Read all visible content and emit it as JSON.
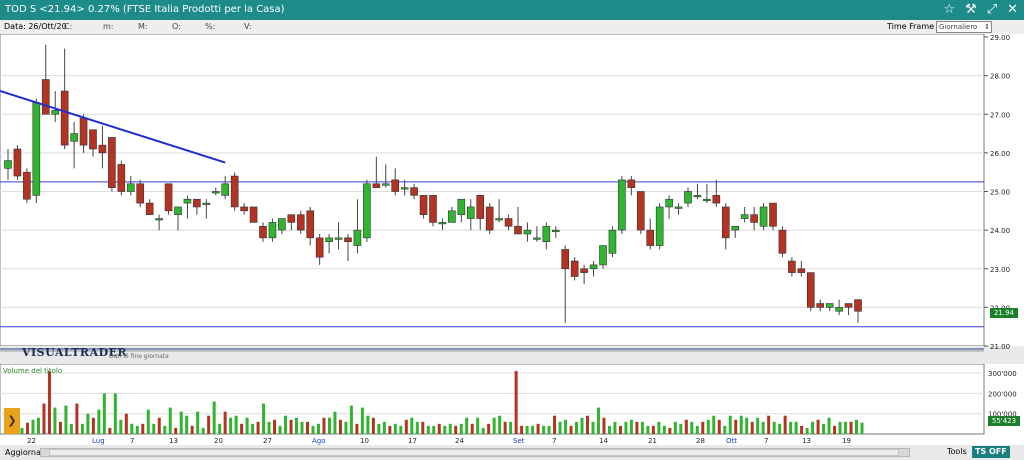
{
  "window": {
    "title": "TOD S <21.94> 0.27%  (FTSE Italia Prodotti per la Casa)",
    "icons": [
      "star-icon",
      "settings-icon",
      "restore-icon",
      "close-icon"
    ]
  },
  "infobar": {
    "data_label": "Data: 26/Ott/20",
    "fields": [
      "C:",
      "m:",
      "M:",
      "O:",
      "%:",
      "V:"
    ],
    "time_frame_label": "Time Frame",
    "time_frame_value": "Giornaliero"
  },
  "chart": {
    "brand": "VISUALTRADER",
    "eod_note": "Dati di fine giornata",
    "volume_label": "Volume del titolo",
    "last_price_label": "21.94",
    "last_volume_label": "55'423",
    "price_ticks": [
      "29.00",
      "28.00",
      "27.00",
      "26.00",
      "25.00",
      "24.00",
      "23.00",
      "22.00",
      "21.00"
    ],
    "volume_ticks": [
      "300'000",
      "200'000",
      "100'000"
    ],
    "x_labels": [
      "22",
      "Lug",
      "7",
      "13",
      "20",
      "27",
      "Ago",
      "10",
      "17",
      "24",
      "Set",
      "7",
      "14",
      "21",
      "28",
      "Ott",
      "7",
      "13",
      "19"
    ],
    "x_labels_blue": [
      "Lug",
      "Ago",
      "Set",
      "Ott"
    ]
  },
  "statusbar": {
    "aggiorna": "Aggiorna",
    "tools": "Tools",
    "ts_off": "TS OFF"
  },
  "colors": {
    "up": "#2fb52f",
    "down": "#b53322",
    "volume": "#2fb52f",
    "accent": "#137f80",
    "trendline": "#1f2fd0",
    "hline": "#3a3ad0"
  },
  "chart_data": {
    "type": "candlestick",
    "title": "TOD S <21.94> 0.27%  (FTSE Italia Prodotti per la Casa)",
    "ylim": [
      21.0,
      29.0
    ],
    "volume_ylim": [
      0,
      300000
    ],
    "candles": [
      {
        "o": 25.6,
        "h": 26.1,
        "l": 25.3,
        "c": 25.8
      },
      {
        "o": 26.1,
        "h": 26.2,
        "l": 25.3,
        "c": 25.4
      },
      {
        "o": 25.5,
        "h": 25.6,
        "l": 24.7,
        "c": 24.8
      },
      {
        "o": 24.9,
        "h": 27.4,
        "l": 24.7,
        "c": 27.3
      },
      {
        "o": 27.9,
        "h": 28.8,
        "l": 27.0,
        "c": 27.0
      },
      {
        "o": 27.0,
        "h": 27.6,
        "l": 26.8,
        "c": 27.1
      },
      {
        "o": 27.6,
        "h": 28.7,
        "l": 26.1,
        "c": 26.2
      },
      {
        "o": 26.3,
        "h": 26.8,
        "l": 25.6,
        "c": 26.5
      },
      {
        "o": 26.9,
        "h": 27.0,
        "l": 26.0,
        "c": 26.2
      },
      {
        "o": 26.6,
        "h": 26.6,
        "l": 25.9,
        "c": 26.1
      },
      {
        "o": 26.2,
        "h": 26.7,
        "l": 25.6,
        "c": 26.0
      },
      {
        "o": 26.4,
        "h": 26.4,
        "l": 25.0,
        "c": 25.1
      },
      {
        "o": 25.7,
        "h": 25.8,
        "l": 24.9,
        "c": 25.0
      },
      {
        "o": 25.0,
        "h": 25.4,
        "l": 24.9,
        "c": 25.2
      },
      {
        "o": 25.2,
        "h": 25.3,
        "l": 24.6,
        "c": 24.7
      },
      {
        "o": 24.7,
        "h": 24.8,
        "l": 24.4,
        "c": 24.4
      },
      {
        "o": 24.3,
        "h": 24.4,
        "l": 24.0,
        "c": 24.3
      },
      {
        "o": 25.2,
        "h": 25.2,
        "l": 24.4,
        "c": 24.5
      },
      {
        "o": 24.4,
        "h": 24.6,
        "l": 24.0,
        "c": 24.6
      },
      {
        "o": 24.7,
        "h": 24.9,
        "l": 24.3,
        "c": 24.8
      },
      {
        "o": 24.8,
        "h": 24.8,
        "l": 24.4,
        "c": 24.6
      },
      {
        "o": 24.7,
        "h": 24.8,
        "l": 24.3,
        "c": 24.7
      },
      {
        "o": 25.0,
        "h": 25.1,
        "l": 24.9,
        "c": 25.0
      },
      {
        "o": 24.9,
        "h": 25.4,
        "l": 24.8,
        "c": 25.2
      },
      {
        "o": 25.4,
        "h": 25.5,
        "l": 24.5,
        "c": 24.6
      },
      {
        "o": 24.6,
        "h": 24.7,
        "l": 24.4,
        "c": 24.5
      },
      {
        "o": 24.6,
        "h": 24.6,
        "l": 24.2,
        "c": 24.2
      },
      {
        "o": 24.1,
        "h": 24.2,
        "l": 23.7,
        "c": 23.8
      },
      {
        "o": 23.8,
        "h": 24.3,
        "l": 23.7,
        "c": 24.2
      },
      {
        "o": 24.0,
        "h": 24.3,
        "l": 23.9,
        "c": 24.3
      },
      {
        "o": 24.4,
        "h": 24.4,
        "l": 24.0,
        "c": 24.2
      },
      {
        "o": 24.4,
        "h": 24.5,
        "l": 23.9,
        "c": 24.0
      },
      {
        "o": 24.5,
        "h": 24.6,
        "l": 23.6,
        "c": 23.8
      },
      {
        "o": 23.8,
        "h": 23.9,
        "l": 23.1,
        "c": 23.3
      },
      {
        "o": 23.7,
        "h": 23.9,
        "l": 23.4,
        "c": 23.8
      },
      {
        "o": 23.8,
        "h": 24.2,
        "l": 23.5,
        "c": 23.8
      },
      {
        "o": 23.8,
        "h": 23.9,
        "l": 23.2,
        "c": 23.7
      },
      {
        "o": 23.6,
        "h": 24.8,
        "l": 23.4,
        "c": 24.0
      },
      {
        "o": 23.8,
        "h": 25.3,
        "l": 23.7,
        "c": 25.2
      },
      {
        "o": 25.2,
        "h": 25.9,
        "l": 25.1,
        "c": 25.1
      },
      {
        "o": 25.2,
        "h": 25.7,
        "l": 25.1,
        "c": 25.2
      },
      {
        "o": 25.3,
        "h": 25.6,
        "l": 24.9,
        "c": 25.0
      },
      {
        "o": 25.1,
        "h": 25.3,
        "l": 24.9,
        "c": 25.1
      },
      {
        "o": 25.1,
        "h": 25.2,
        "l": 24.8,
        "c": 24.9
      },
      {
        "o": 24.9,
        "h": 24.9,
        "l": 24.3,
        "c": 24.4
      },
      {
        "o": 24.9,
        "h": 24.9,
        "l": 24.1,
        "c": 24.2
      },
      {
        "o": 24.2,
        "h": 24.3,
        "l": 24.0,
        "c": 24.2
      },
      {
        "o": 24.2,
        "h": 24.6,
        "l": 24.2,
        "c": 24.5
      },
      {
        "o": 24.4,
        "h": 24.8,
        "l": 24.2,
        "c": 24.8
      },
      {
        "o": 24.3,
        "h": 24.8,
        "l": 24.0,
        "c": 24.6
      },
      {
        "o": 24.9,
        "h": 24.9,
        "l": 24.0,
        "c": 24.3
      },
      {
        "o": 24.6,
        "h": 24.7,
        "l": 23.9,
        "c": 24.0
      },
      {
        "o": 24.3,
        "h": 24.8,
        "l": 24.2,
        "c": 24.3
      },
      {
        "o": 24.3,
        "h": 24.4,
        "l": 24.0,
        "c": 24.1
      },
      {
        "o": 24.1,
        "h": 24.6,
        "l": 23.9,
        "c": 23.9
      },
      {
        "o": 23.9,
        "h": 24.2,
        "l": 23.7,
        "c": 24.0
      },
      {
        "o": 23.8,
        "h": 24.1,
        "l": 23.7,
        "c": 23.8
      },
      {
        "o": 23.7,
        "h": 24.2,
        "l": 23.5,
        "c": 24.1
      },
      {
        "o": 24.0,
        "h": 24.1,
        "l": 23.8,
        "c": 24.0
      },
      {
        "o": 23.5,
        "h": 23.6,
        "l": 21.6,
        "c": 23.0
      },
      {
        "o": 23.2,
        "h": 23.3,
        "l": 22.7,
        "c": 22.8
      },
      {
        "o": 23.0,
        "h": 23.1,
        "l": 22.6,
        "c": 22.9
      },
      {
        "o": 23.0,
        "h": 23.2,
        "l": 22.8,
        "c": 23.1
      },
      {
        "o": 23.1,
        "h": 23.6,
        "l": 23.0,
        "c": 23.6
      },
      {
        "o": 23.4,
        "h": 24.1,
        "l": 23.3,
        "c": 24.0
      },
      {
        "o": 24.0,
        "h": 25.4,
        "l": 23.9,
        "c": 25.3
      },
      {
        "o": 25.3,
        "h": 25.4,
        "l": 24.9,
        "c": 25.1
      },
      {
        "o": 25.0,
        "h": 25.0,
        "l": 23.9,
        "c": 24.0
      },
      {
        "o": 24.0,
        "h": 24.3,
        "l": 23.5,
        "c": 23.6
      },
      {
        "o": 23.6,
        "h": 24.7,
        "l": 23.5,
        "c": 24.6
      },
      {
        "o": 24.6,
        "h": 24.9,
        "l": 24.3,
        "c": 24.8
      },
      {
        "o": 24.6,
        "h": 24.7,
        "l": 24.4,
        "c": 24.6
      },
      {
        "o": 24.7,
        "h": 25.1,
        "l": 24.6,
        "c": 25.0
      },
      {
        "o": 24.9,
        "h": 25.2,
        "l": 24.8,
        "c": 24.9
      },
      {
        "o": 24.8,
        "h": 25.2,
        "l": 24.7,
        "c": 24.8
      },
      {
        "o": 24.9,
        "h": 25.3,
        "l": 24.6,
        "c": 24.7
      },
      {
        "o": 24.6,
        "h": 24.7,
        "l": 23.5,
        "c": 23.8
      },
      {
        "o": 24.0,
        "h": 24.1,
        "l": 23.8,
        "c": 24.1
      },
      {
        "o": 24.3,
        "h": 24.6,
        "l": 24.2,
        "c": 24.4
      },
      {
        "o": 24.4,
        "h": 24.6,
        "l": 24.0,
        "c": 24.2
      },
      {
        "o": 24.1,
        "h": 24.7,
        "l": 24.0,
        "c": 24.6
      },
      {
        "o": 24.7,
        "h": 24.7,
        "l": 24.0,
        "c": 24.1
      },
      {
        "o": 24.0,
        "h": 24.1,
        "l": 23.3,
        "c": 23.4
      },
      {
        "o": 23.2,
        "h": 23.3,
        "l": 22.8,
        "c": 22.9
      },
      {
        "o": 23.0,
        "h": 23.2,
        "l": 22.8,
        "c": 22.9
      },
      {
        "o": 22.9,
        "h": 22.9,
        "l": 21.9,
        "c": 22.0
      },
      {
        "o": 22.1,
        "h": 22.2,
        "l": 21.9,
        "c": 22.0
      },
      {
        "o": 22.0,
        "h": 22.1,
        "l": 21.9,
        "c": 22.1
      },
      {
        "o": 21.9,
        "h": 22.2,
        "l": 21.8,
        "c": 22.0
      },
      {
        "o": 22.1,
        "h": 22.1,
        "l": 21.8,
        "c": 22.0
      },
      {
        "o": 22.2,
        "h": 22.2,
        "l": 21.6,
        "c": 21.9
      }
    ],
    "volumes": [
      30000,
      55000,
      70000,
      80000,
      150000,
      310000,
      130000,
      60000,
      140000,
      50000,
      150000,
      50000,
      100000,
      80000,
      120000,
      200000,
      30000,
      200000,
      70000,
      100000,
      50000,
      40000,
      50000,
      120000,
      50000,
      80000,
      40000,
      130000,
      30000,
      110000,
      90000,
      40000,
      110000,
      30000,
      90000,
      160000,
      50000,
      110000,
      80000,
      90000,
      50000,
      80000,
      50000,
      60000,
      150000,
      60000,
      70000,
      40000,
      90000,
      70000,
      80000,
      60000,
      60000,
      40000,
      50000,
      80000,
      80000,
      110000,
      70000,
      60000,
      140000,
      50000,
      130000,
      90000,
      80000,
      50000,
      60000,
      40000,
      50000,
      40000,
      70000,
      80000,
      60000,
      60000,
      40000,
      40000,
      50000,
      40000,
      50000,
      40000,
      50000,
      80000,
      50000,
      80000,
      30000,
      50000,
      80000,
      90000,
      60000,
      60000,
      310000,
      40000,
      40000,
      40000,
      50000,
      40000,
      40000,
      90000,
      60000,
      70000,
      40000,
      60000,
      80000,
      90000,
      60000,
      130000,
      80000,
      40000,
      60000,
      40000,
      60000,
      70000,
      60000,
      60000,
      40000,
      40000,
      60000,
      40000,
      30000,
      60000,
      50000,
      70000,
      60000,
      40000,
      60000,
      70000,
      90000,
      70000,
      40000,
      90000,
      70000,
      90000,
      80000,
      60000,
      80000,
      60000,
      90000,
      60000,
      50000,
      90000,
      60000,
      60000,
      40000,
      30000,
      60000,
      70000,
      50000,
      80000,
      40000,
      60000,
      60000,
      60000,
      70000,
      55423
    ],
    "horizontal_lines": [
      25.25,
      21.5
    ],
    "trendline": {
      "from": [
        0,
        27.55
      ],
      "to": [
        23,
        25.75
      ]
    }
  }
}
